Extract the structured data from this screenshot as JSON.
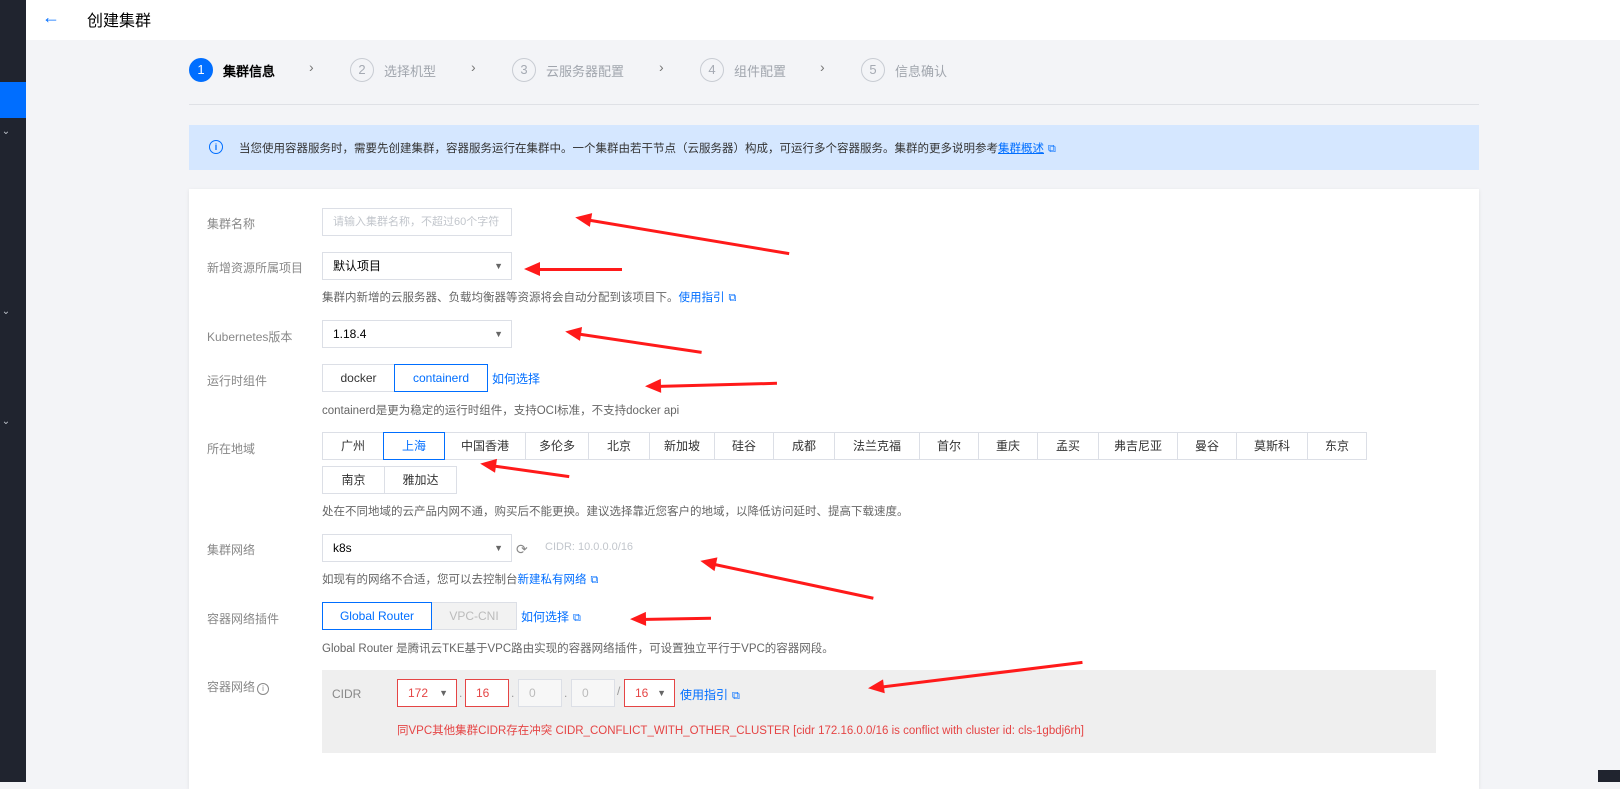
{
  "header": {
    "back_icon": "arrow-left-icon",
    "title": "创建集群"
  },
  "steps": [
    {
      "num": "1",
      "label": "集群信息",
      "active": true
    },
    {
      "num": "2",
      "label": "选择机型"
    },
    {
      "num": "3",
      "label": "云服务器配置"
    },
    {
      "num": "4",
      "label": "组件配置"
    },
    {
      "num": "5",
      "label": "信息确认"
    }
  ],
  "notice": {
    "icon": "info-icon",
    "text": "当您使用容器服务时，需要先创建集群，容器服务运行在集群中。一个集群由若干节点（云服务器）构成，可运行多个容器服务。集群的更多说明参考",
    "link": "集群概述"
  },
  "form": {
    "cluster_name": {
      "label": "集群名称",
      "placeholder": "请输入集群名称，不超过60个字符"
    },
    "project": {
      "label": "新增资源所属项目",
      "value": "默认项目",
      "hint": "集群内新增的云服务器、负载均衡器等资源将会自动分配到该项目下。",
      "hint_link": "使用指引"
    },
    "k8s_version": {
      "label": "Kubernetes版本",
      "value": "1.18.4"
    },
    "runtime": {
      "label": "运行时组件",
      "options": [
        "docker",
        "containerd"
      ],
      "selected": "containerd",
      "help_link": "如何选择",
      "hint": "containerd是更为稳定的运行时组件，支持OCI标准，不支持docker api"
    },
    "region": {
      "label": "所在地域",
      "row1": [
        "广州",
        "上海",
        "中国香港",
        "多伦多",
        "北京",
        "新加坡",
        "硅谷",
        "成都",
        "法兰克福",
        "首尔",
        "重庆",
        "孟买",
        "弗吉尼亚",
        "曼谷",
        "莫斯科",
        "东京"
      ],
      "row2": [
        "南京",
        "雅加达"
      ],
      "selected": "上海",
      "hint": "处在不同地域的云产品内网不通，购买后不能更换。建议选择靠近您客户的地域，以降低访问延时、提高下载速度。"
    },
    "network": {
      "label": "集群网络",
      "value": "k8s",
      "cidr_note": "CIDR: 10.0.0.0/16",
      "hint": "如现有的网络不合适，您可以去控制台",
      "hint_link": "新建私有网络"
    },
    "network_plugin": {
      "label": "容器网络插件",
      "options": [
        "Global Router",
        "VPC-CNI"
      ],
      "help_link": "如何选择",
      "hint": "Global Router 是腾讯云TKE基于VPC路由实现的容器网络插件，可设置独立平行于VPC的容器网段。"
    },
    "container_network": {
      "label": "容器网络",
      "cidr_label": "CIDR",
      "octet1": "172",
      "octet2": "16",
      "octet3": "0",
      "octet4": "0",
      "mask": "16",
      "help_link": "使用指引",
      "error": "同VPC其他集群CIDR存在冲突 CIDR_CONFLICT_WITH_OTHER_CLUSTER [cidr 172.16.0.0/16 is conflict with cluster id: cls-1gbdj6rh]"
    }
  },
  "colors": {
    "accent": "#006eff",
    "error": "#e54545",
    "annotation_arrow": "#ff1a1a"
  }
}
